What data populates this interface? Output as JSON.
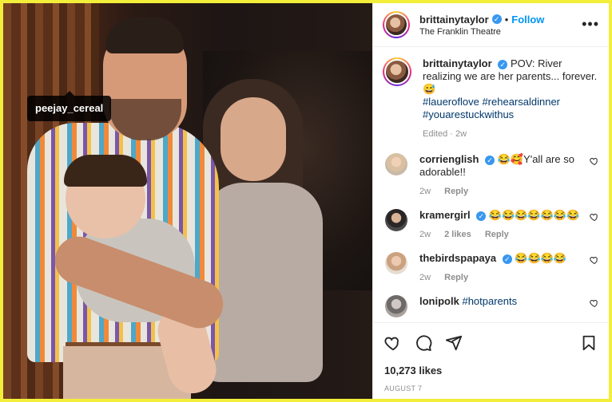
{
  "photo": {
    "tag": "peejay_cereal"
  },
  "header": {
    "username": "brittainytaylor",
    "follow": "Follow",
    "dot": "•",
    "location": "The Franklin Theatre",
    "more": "•••"
  },
  "caption": {
    "username": "brittainytaylor",
    "text": "POV: River realizing we are her parents... forever. 😅",
    "hashtags": "#laueroflove #rehearsaldinner #youarestuckwithus",
    "edited": "Edited · 2w"
  },
  "comments": [
    {
      "username": "corrienglish",
      "text": "😂🥰Y'all are so adorable!!",
      "time": "2w",
      "likes": "",
      "reply": "Reply"
    },
    {
      "username": "kramergirl",
      "text": "😂😂😂😂😂😂😂",
      "time": "2w",
      "likes": "2 likes",
      "reply": "Reply"
    },
    {
      "username": "thebirdspapaya",
      "text": "😂😂😂😂",
      "time": "2w",
      "likes": "",
      "reply": "Reply"
    },
    {
      "username": "lonipolk",
      "text": "#hotparents",
      "time": "",
      "likes": "",
      "reply": ""
    }
  ],
  "footer": {
    "likes": "10,273 likes",
    "date": "AUGUST 7"
  },
  "colors": {
    "accent": "#0095f6",
    "frame": "#f2ee3a",
    "hashtag": "#00376b"
  }
}
